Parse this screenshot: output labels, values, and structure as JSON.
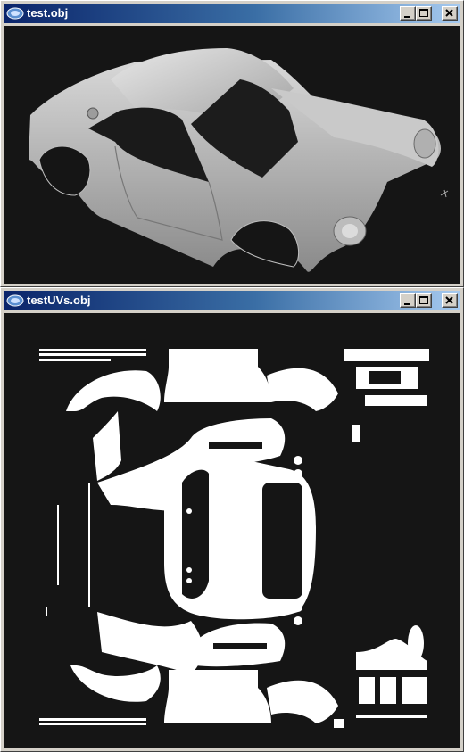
{
  "windows": [
    {
      "title": "test.obj",
      "view": "3d-car-model-viewport"
    },
    {
      "title": "testUVs.obj",
      "view": "uv-layout-viewport"
    }
  ],
  "titlebar_buttons": [
    "minimize",
    "maximize",
    "close"
  ],
  "colors": {
    "titlebar_start": "#0a246a",
    "titlebar_end": "#a6caf0",
    "viewport_bg": "#151515",
    "window_face": "#d4d0c8",
    "uv_fill": "#ffffff"
  },
  "icons": [
    "app-icon",
    "minimize-icon",
    "maximize-icon",
    "close-icon"
  ]
}
